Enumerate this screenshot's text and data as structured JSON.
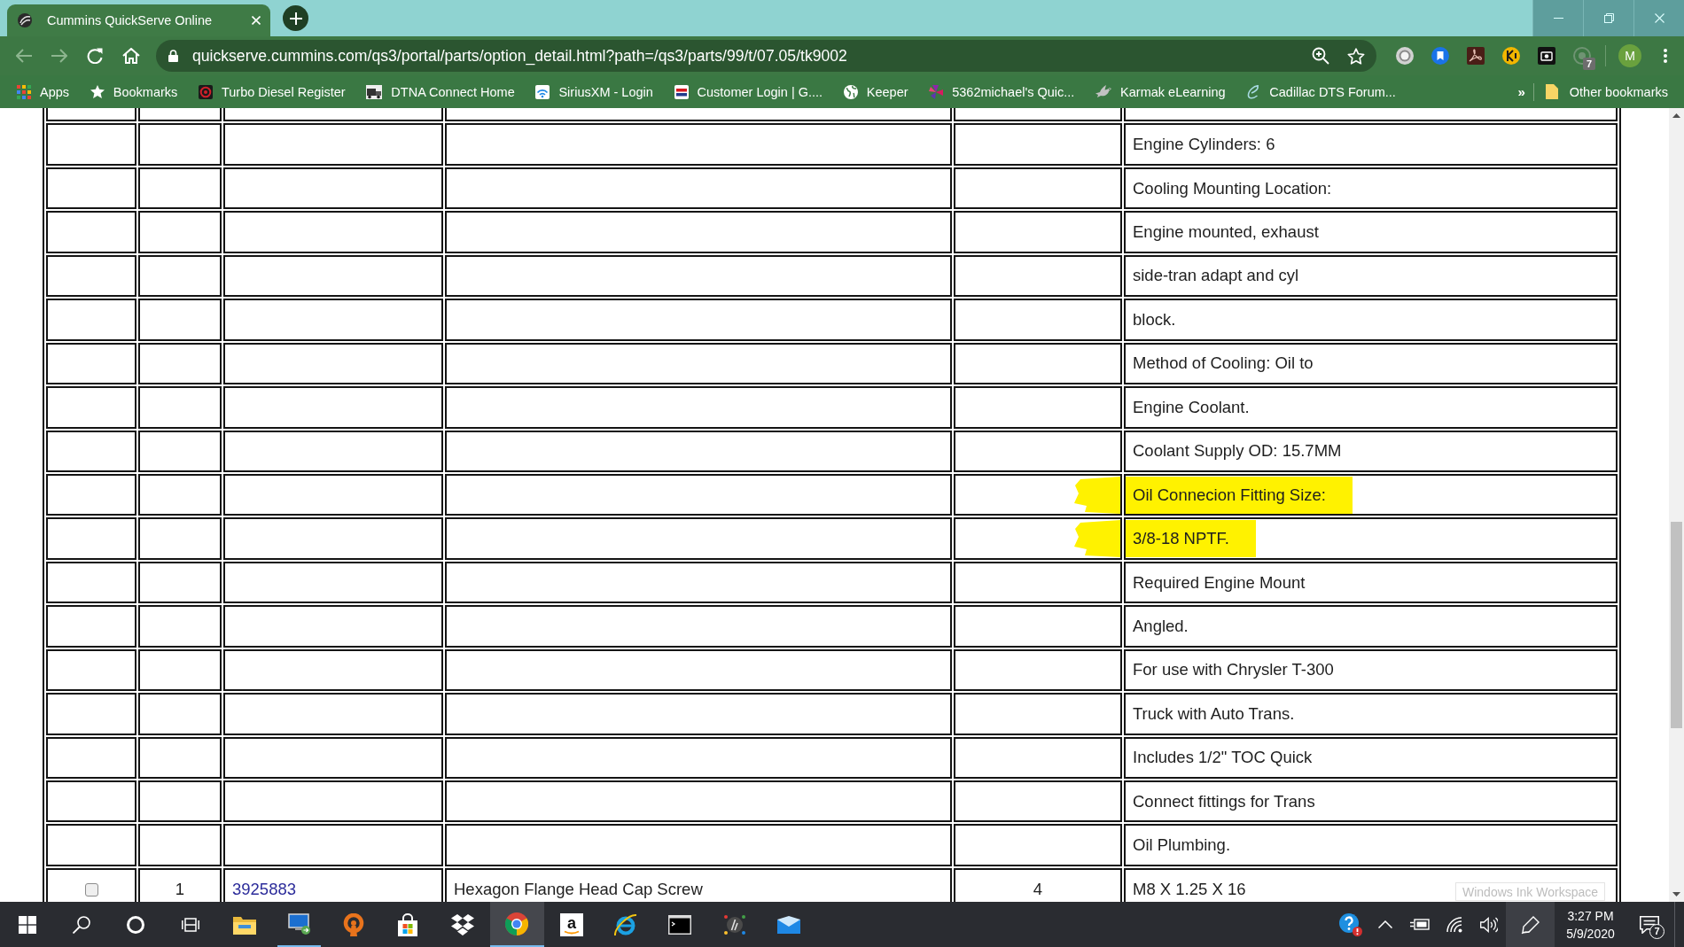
{
  "window": {
    "tab": {
      "title": "Cummins QuickServe Online"
    }
  },
  "toolbar": {
    "back_disabled": true,
    "forward_disabled": true,
    "address": "quickserve.cummins.com/qs3/portal/parts/option_detail.html?path=/qs3/parts/99/t/07.05/tk9002",
    "extension_badge": "7",
    "profile_initial": "M"
  },
  "bookmarks_bar": {
    "items": [
      {
        "kind": "apps",
        "label": "Apps"
      },
      {
        "kind": "star",
        "label": "Bookmarks"
      },
      {
        "kind": "disc",
        "label": "Turbo Diesel Register"
      },
      {
        "kind": "truck",
        "label": "DTNA Connect Home"
      },
      {
        "kind": "signal",
        "label": "SiriusXM - Login"
      },
      {
        "kind": "flag",
        "label": "Customer Login | G...."
      },
      {
        "kind": "globe",
        "label": "Keeper"
      },
      {
        "kind": "pinwheel",
        "label": "5362michael's Quic..."
      },
      {
        "kind": "bird",
        "label": "Karmak eLearning"
      },
      {
        "kind": "script",
        "label": "Cadillac DTS Forum..."
      }
    ],
    "overflow": "»",
    "other_bookmarks": "Other bookmarks"
  },
  "table": {
    "rows": [
      {
        "kind": "note",
        "highlighted": false
      },
      {
        "kind": "note",
        "note": "Engine Cylinders: 6",
        "highlighted": false
      },
      {
        "kind": "note",
        "note": "Cooling Mounting Location:",
        "highlighted": false
      },
      {
        "kind": "note",
        "note": "Engine mounted, exhaust",
        "highlighted": false
      },
      {
        "kind": "note",
        "note": "side-tran adapt and cyl",
        "highlighted": false
      },
      {
        "kind": "note",
        "note": "block.",
        "highlighted": false
      },
      {
        "kind": "note",
        "note": "Method of Cooling: Oil to",
        "highlighted": false
      },
      {
        "kind": "note",
        "note": "Engine Coolant.",
        "highlighted": false
      },
      {
        "kind": "note",
        "note": "Coolant Supply OD: 15.7MM",
        "highlighted": false
      },
      {
        "kind": "note",
        "note": "Oil Connecion Fitting Size:",
        "highlighted": true
      },
      {
        "kind": "note",
        "note": "3/8-18 NPTF.",
        "highlighted": true
      },
      {
        "kind": "note",
        "note": "Required Engine Mount",
        "highlighted": false
      },
      {
        "kind": "note",
        "note": "Angled.",
        "highlighted": false
      },
      {
        "kind": "note",
        "note": "For use with Chrysler T-300",
        "highlighted": false
      },
      {
        "kind": "note",
        "note": "Truck with Auto Trans.",
        "highlighted": false
      },
      {
        "kind": "note",
        "note": "Includes 1/2\" TOC Quick",
        "highlighted": false
      },
      {
        "kind": "note",
        "note": "Connect fittings for Trans",
        "highlighted": false
      },
      {
        "kind": "note",
        "note": "Oil Plumbing.",
        "highlighted": false
      },
      {
        "kind": "part",
        "checked": false,
        "column_2": "1",
        "part_number": "3925883",
        "description": "Hexagon Flange Head Cap Screw",
        "column_5": "4",
        "note": "M8 X 1.25 X 16",
        "highlighted": false
      }
    ]
  },
  "tooltip": {
    "text": "Windows Ink Workspace"
  },
  "taskbar": {
    "apps": [
      {
        "kind": "folder",
        "running": false,
        "selected": false
      },
      {
        "kind": "remote",
        "running": true,
        "selected": false
      },
      {
        "kind": "keyhole",
        "running": false,
        "selected": false
      },
      {
        "kind": "store",
        "running": false,
        "selected": false
      },
      {
        "kind": "dropbox",
        "running": false,
        "selected": false
      },
      {
        "kind": "chrome",
        "running": true,
        "selected": true
      },
      {
        "kind": "amazon",
        "glyph": "a",
        "running": false,
        "selected": false
      },
      {
        "kind": "ie",
        "running": false,
        "selected": false
      },
      {
        "kind": "terminal",
        "running": false,
        "selected": false
      },
      {
        "kind": "hp",
        "running": false,
        "selected": false
      },
      {
        "kind": "mail",
        "running": false,
        "selected": false
      }
    ],
    "tray": [
      {
        "kind": "help",
        "hovered": false
      },
      {
        "kind": "chevron",
        "hovered": false
      },
      {
        "kind": "battery",
        "hovered": false
      },
      {
        "kind": "wifi",
        "hovered": false
      },
      {
        "kind": "volume",
        "hovered": false
      },
      {
        "kind": "pen",
        "hovered": true
      }
    ],
    "time": "3:27 PM",
    "date": "5/9/2020",
    "notification_count": "7"
  }
}
